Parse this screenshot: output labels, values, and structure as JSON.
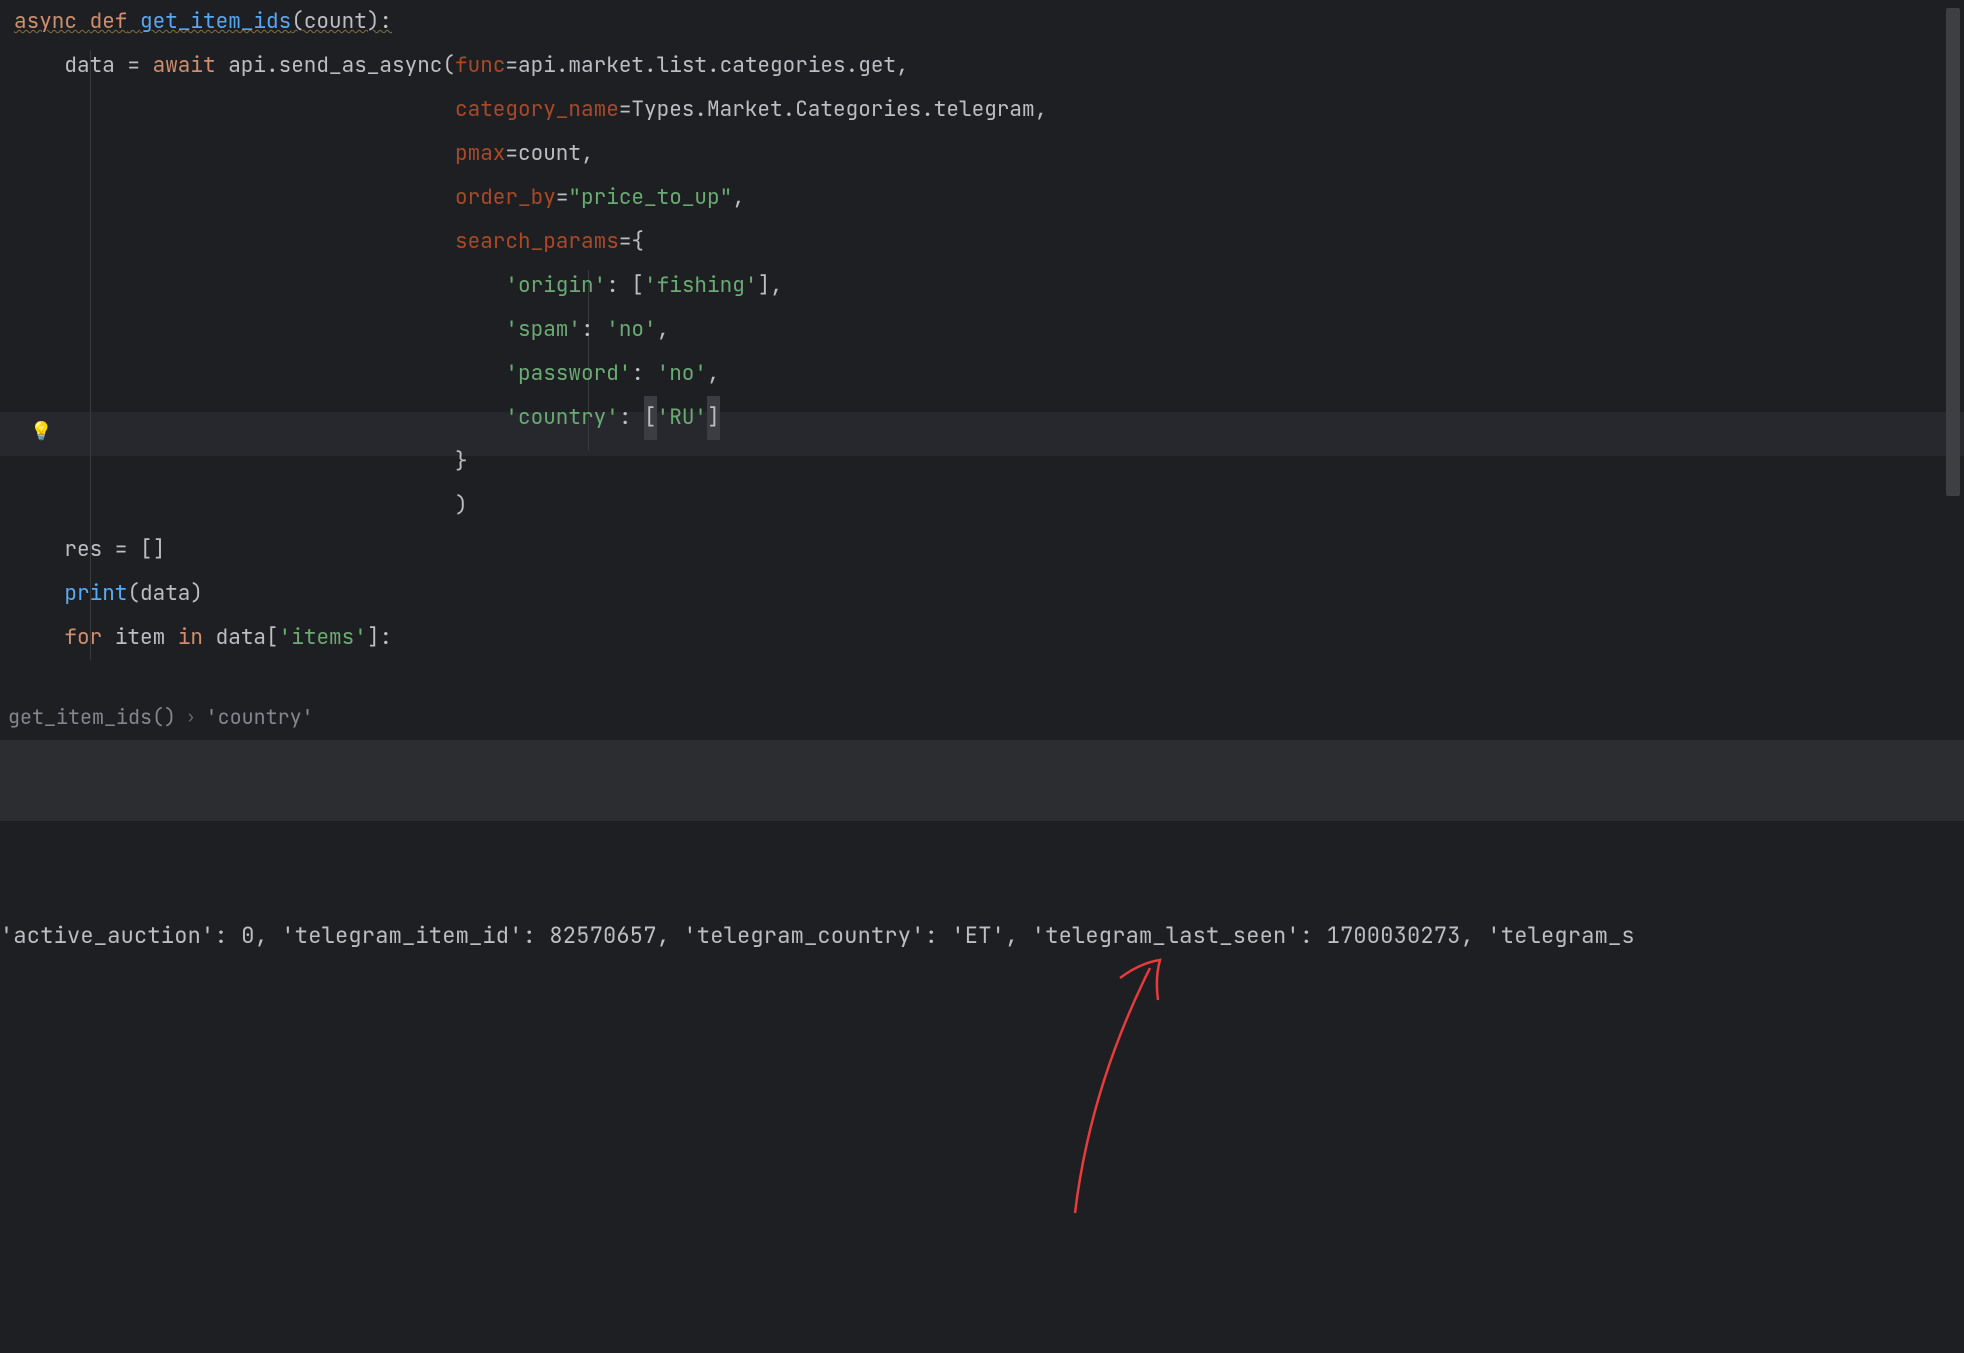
{
  "code": {
    "line1": {
      "async": "async",
      "def": "def",
      "funcname": "get_item_ids",
      "params": "(count):"
    },
    "line2": {
      "prefix": "    data = ",
      "await": "await",
      "call": " api.send_as_async(",
      "param": "func",
      "rest": "=api.market.list.categories.get,"
    },
    "line3": {
      "param": "category_name",
      "rest": "=Types.Market.Categories.telegram,"
    },
    "line4": {
      "param": "pmax",
      "rest": "=count,"
    },
    "line5": {
      "param": "order_by",
      "eq": "=",
      "str": "\"price_to_up\"",
      "comma": ","
    },
    "line6": {
      "param": "search_params",
      "rest": "={"
    },
    "line7": {
      "k": "'origin'",
      "mid": ": [",
      "v": "'fishing'",
      "end": "],"
    },
    "line8": {
      "k": "'spam'",
      "mid": ": ",
      "v": "'no'",
      "end": ","
    },
    "line9": {
      "k": "'password'",
      "mid": ": ",
      "v": "'no'",
      "end": ","
    },
    "line10": {
      "k": "'country'",
      "mid": ": ",
      "b1": "[",
      "v": "'RU'",
      "b2": "]"
    },
    "line11": "}",
    "line12": ")",
    "line13": "    res = []",
    "line14": {
      "print": "print",
      "rest": "(data)"
    },
    "line15": {
      "for": "for",
      "sp1": " item ",
      "in": "in",
      "sp2": " data[",
      "str": "'items'",
      "end": "]:"
    }
  },
  "breadcrumb": {
    "item1": "get_item_ids()",
    "item2": "'country'"
  },
  "terminal": {
    "output": "'active_auction': 0, 'telegram_item_id': 82570657, 'telegram_country': 'ET', 'telegram_last_seen': 1700030273, 'telegram_s"
  },
  "icons": {
    "bulb": "💡"
  }
}
